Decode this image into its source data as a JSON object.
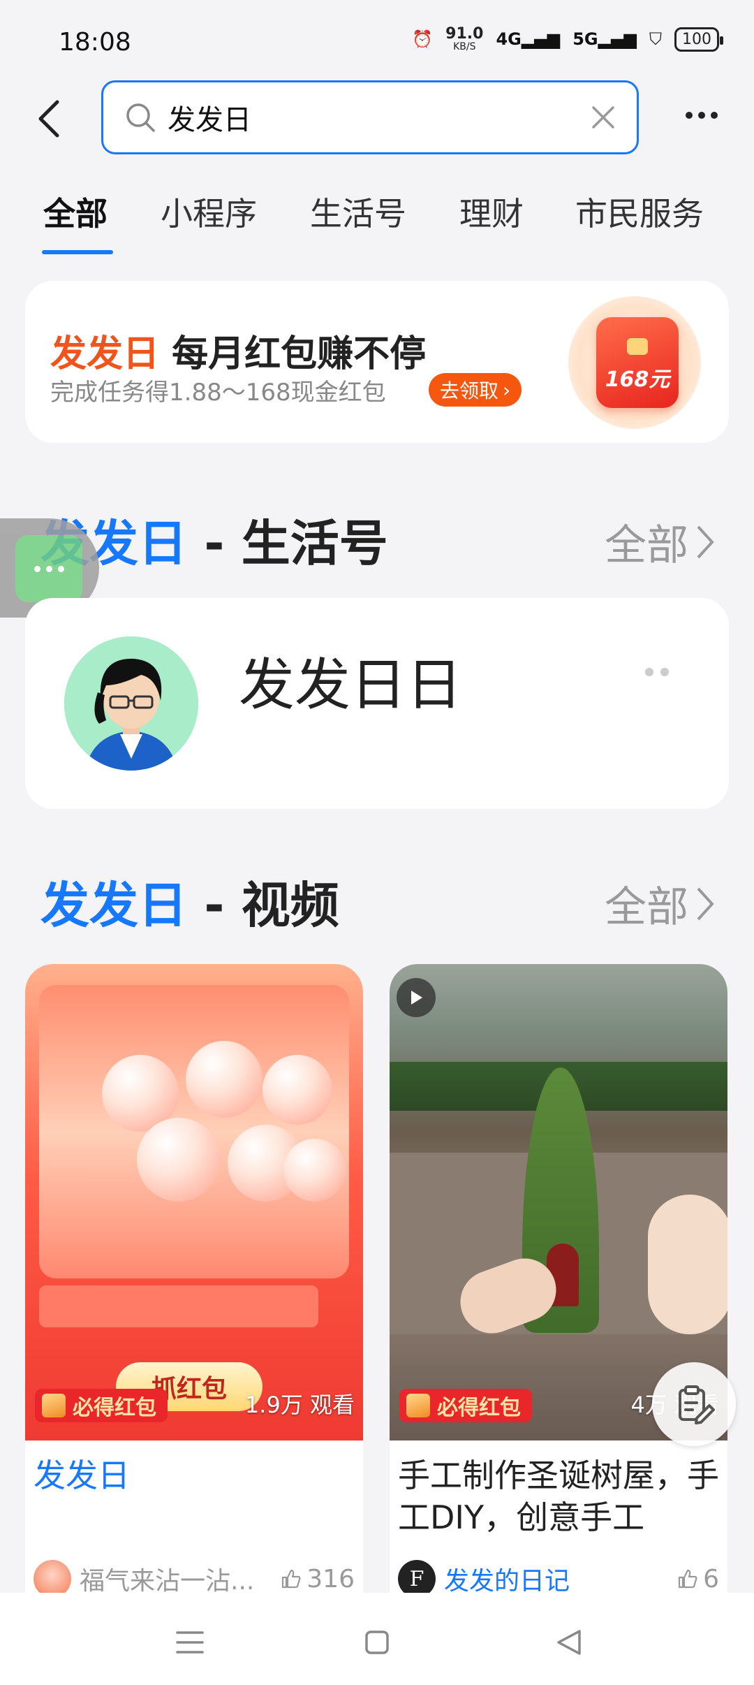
{
  "status_bar": {
    "time": "18:08",
    "speed_top": "91.0",
    "speed_bottom": "KB/S",
    "net1": "4G",
    "net2": "5G",
    "battery": "100"
  },
  "search": {
    "query": "发发日"
  },
  "tabs": [
    "全部",
    "小程序",
    "生活号",
    "理财",
    "市民服务"
  ],
  "banner": {
    "highlight": "发发日",
    "title": "每月红包赚不停",
    "subtitle": "完成任务得1.88～168现金红包",
    "cta": "去领取",
    "cta_arrow": "›",
    "packet_text": "168元"
  },
  "life_section": {
    "keyword": "发发日",
    "title": " - 生活号",
    "all_label": "全部",
    "account_name": "发发日日"
  },
  "video_section": {
    "keyword": "发发日",
    "title": " - 视频",
    "all_label": "全部"
  },
  "videos": [
    {
      "badge": "必得红包",
      "views": "1.9万 观看",
      "thumb_button": "抓红包",
      "title": "发发日",
      "author": "福气来沾一沾...",
      "likes": "316"
    },
    {
      "badge": "必得红包",
      "views": "4万 观看",
      "title": "手工制作圣诞树屋，手工DIY，创意手工",
      "author": "发发的日记",
      "likes": "6"
    }
  ],
  "colors": {
    "accent": "#1677ff",
    "orange": "#f0541a",
    "red": "#e9272a"
  }
}
